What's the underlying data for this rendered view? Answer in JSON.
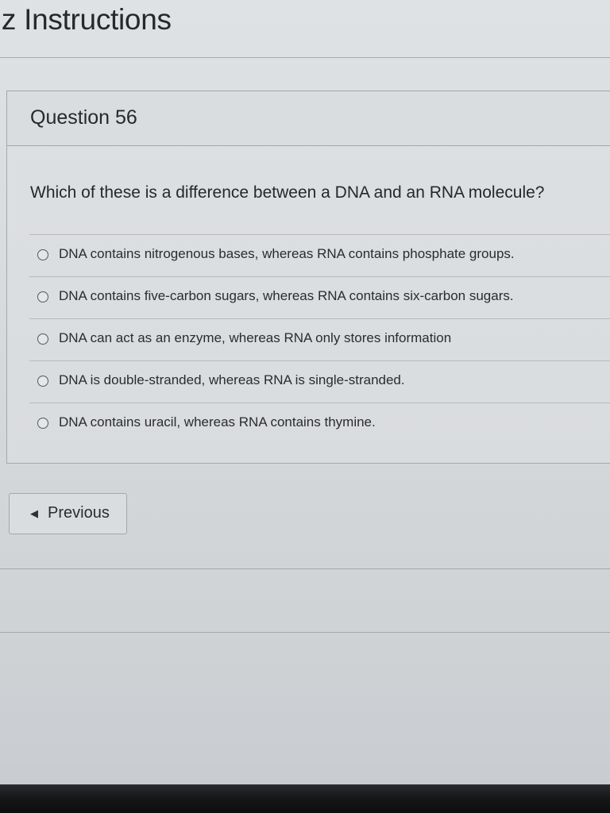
{
  "header": {
    "title": "iz Instructions"
  },
  "question": {
    "number_label": "Question 56",
    "text": "Which of these is a difference between a DNA and an RNA molecule?",
    "options": [
      {
        "label": "DNA contains nitrogenous bases, whereas RNA contains phosphate groups.",
        "selected": false
      },
      {
        "label": "DNA contains five-carbon sugars, whereas RNA contains six-carbon sugars.",
        "selected": false
      },
      {
        "label": "DNA can act as an enzyme, whereas RNA only stores information",
        "selected": false
      },
      {
        "label": "DNA is double-stranded, whereas RNA is single-stranded.",
        "selected": false
      },
      {
        "label": "DNA contains uracil, whereas RNA contains thymine.",
        "selected": false
      }
    ]
  },
  "navigation": {
    "previous_label": "Previous",
    "previous_icon": "left-arrow-icon"
  }
}
